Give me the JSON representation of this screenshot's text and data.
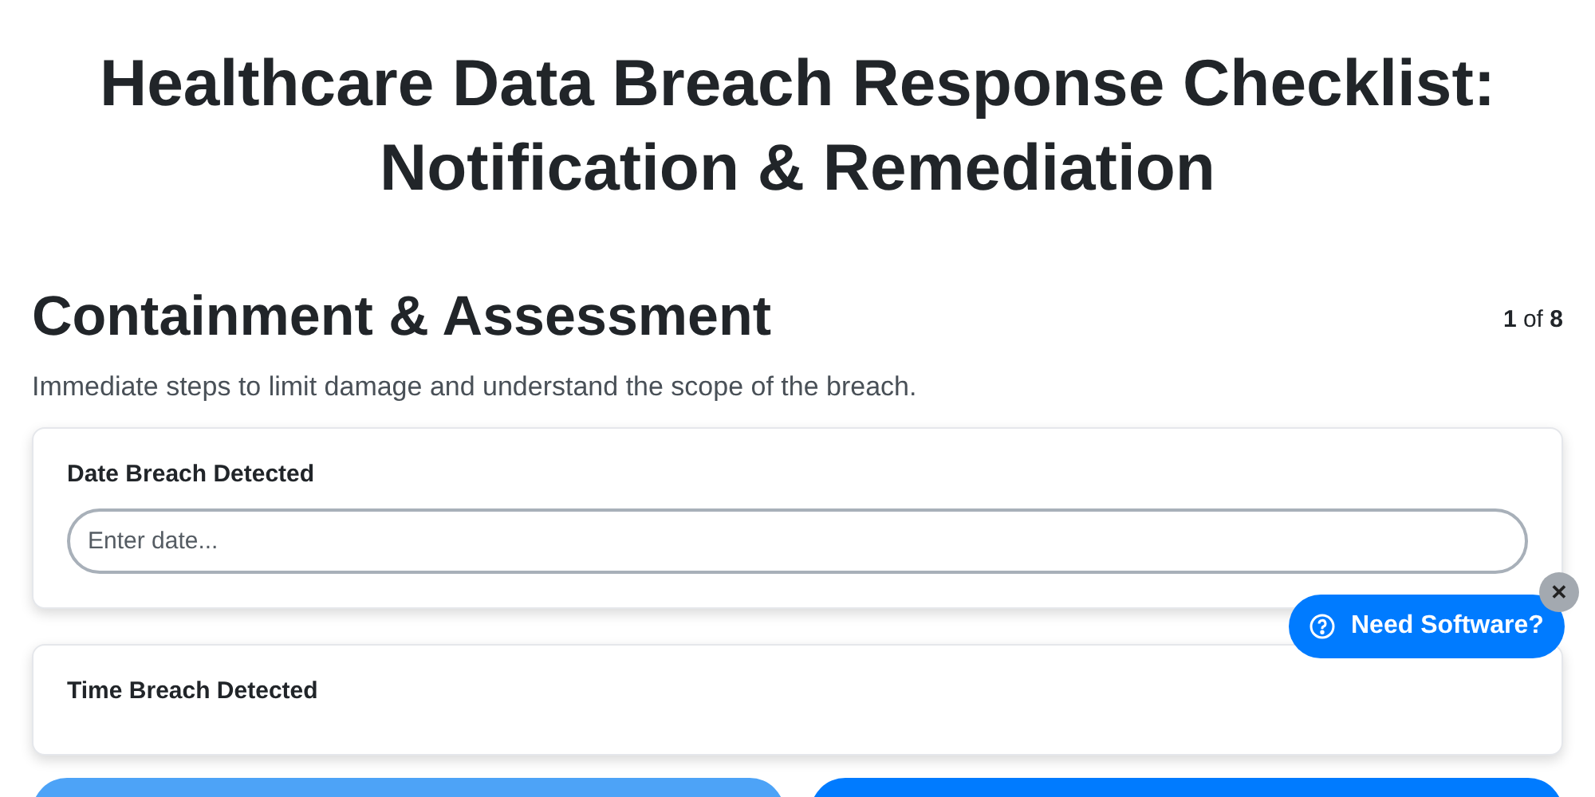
{
  "title": "Healthcare Data Breach Response Checklist: Notification & Remediation",
  "section": {
    "heading": "Containment & Assessment",
    "counter": "**1** of **8**",
    "description": "Immediate steps to limit damage and understand the scope of the breach."
  },
  "fields": [
    {
      "label": "Date Breach Detected",
      "placeholder": "Enter date..."
    },
    {
      "label": "Time Breach Detected"
    }
  ],
  "help_widget": {
    "label": "Need Software?",
    "close": "✕"
  }
}
